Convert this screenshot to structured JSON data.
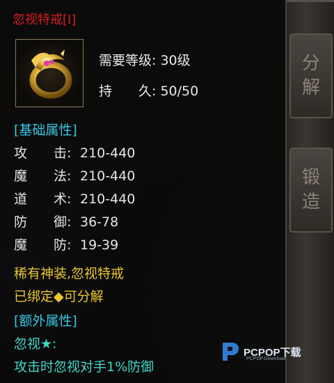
{
  "item": {
    "name": "忽视特戒[I]",
    "required_level_label": "需要等级:",
    "required_level_value": "30级",
    "durability_label": "持　　久:",
    "durability_value": "50/50"
  },
  "base_attributes": {
    "header": "[基础属性]",
    "rows": [
      {
        "label": "攻　　击:",
        "value": "210-440"
      },
      {
        "label": "魔　　法:",
        "value": "210-440"
      },
      {
        "label": "道　　术:",
        "value": "210-440"
      },
      {
        "label": "防　　御:",
        "value": "36-78"
      },
      {
        "label": "魔　　防:",
        "value": "19-39"
      }
    ]
  },
  "notes": {
    "rarity": "稀有神装,忽视特戒",
    "binding": "已绑定◆可分解"
  },
  "extra_attributes": {
    "header": "[额外属性]",
    "skill_name": "忽视★:",
    "skill_desc": "攻击时忽视对手1%防御"
  },
  "side_buttons": {
    "decompose": [
      "分",
      "解"
    ],
    "forge": [
      "锻",
      "造"
    ]
  },
  "watermark": {
    "text": "PCPOP下载",
    "sub": "PCPOP.Download"
  },
  "colors": {
    "name": "#d51d1d",
    "section": "#38c7e4",
    "note": "#e8c62e",
    "extra": "#43d6c8"
  }
}
